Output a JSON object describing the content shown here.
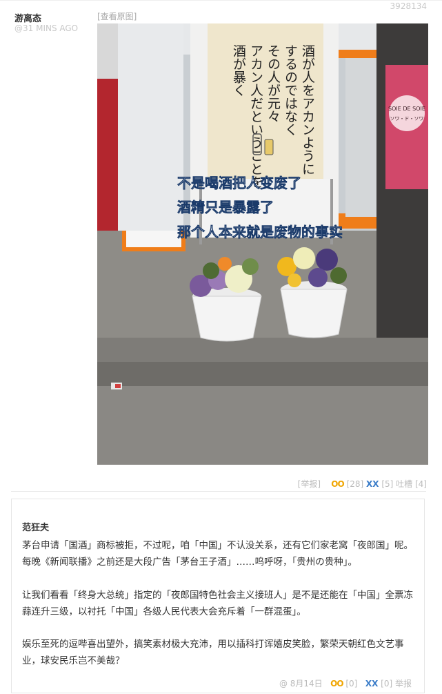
{
  "post": {
    "id": "3928134",
    "author": "游离态",
    "time": "@31 MINS AGO",
    "view_original": "[查看原图]",
    "image": {
      "caption_lines": [
        "不是喝酒把人变废了",
        "酒精只是暴露了",
        "那个人本来就是废物的事实"
      ],
      "sign_lines": [
        "酒が人をアカンように",
        "するのではなく",
        "その人が元々",
        "アカン人だということを",
        "酒が暴く"
      ],
      "shop_sign": "SOIE DE SOIE",
      "shop_sign_sub": "ソワ・ド・ソワ"
    },
    "actions": {
      "report": "[举报]",
      "oo_icon": "OO",
      "oo_count": "[28]",
      "xx_icon": "XX",
      "xx_count": "[5]",
      "tucao": "吐槽 [4]"
    }
  },
  "comment": {
    "author": "范狂夫",
    "paragraphs": [
      "茅台申请「国酒」商标被拒，不过呢，咱「中国」不认没关系，还有它们家老窝「夜郎国」呢。每晚《新闻联播》之前还是大段广告「茅台王子酒」……呜呼呀，「贵州の贵种」。",
      "让我们看看「终身大总统」指定的「夜郎国特色社会主义接班人」是不是还能在「中国」全票冻蒜连升三级，以衬托「中国」各级人民代表大会充斥着「一群混蛋」。",
      "娱乐至死的逗哔喜出望外，搞笑素材极大充沛，用以插科打诨嬉皮笑脸，繁荣天朝红色文艺事业，球安民乐岂不美哉？"
    ],
    "footer": {
      "at": "@",
      "date": "8月14日",
      "oo_icon": "OO",
      "oo_count": "[0]",
      "xx_icon": "XX",
      "xx_count": "[0]",
      "report": "举报"
    }
  }
}
